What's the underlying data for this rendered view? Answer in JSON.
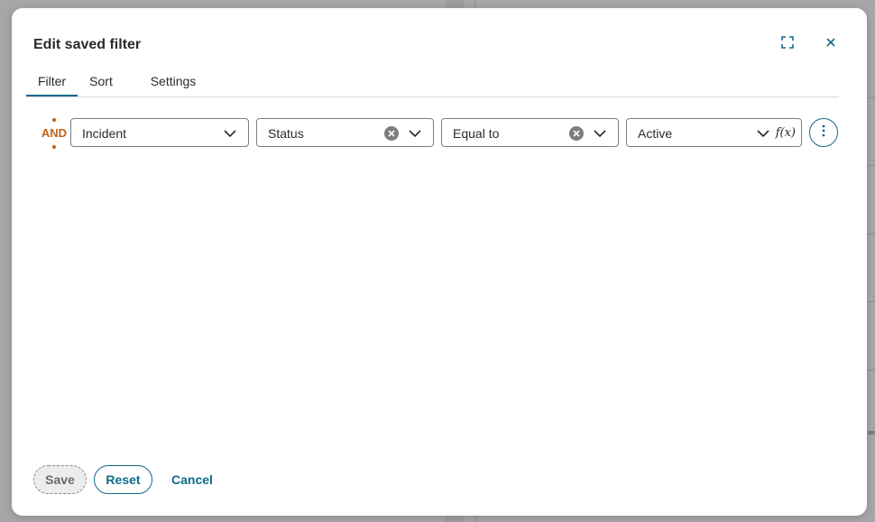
{
  "dialog": {
    "title": "Edit saved filter",
    "expand_icon": "expand-icon",
    "close_icon": "close-icon"
  },
  "tabs": [
    {
      "label": "Filter",
      "active": true
    },
    {
      "label": "Sort",
      "active": false
    },
    {
      "label": "Settings",
      "active": false
    }
  ],
  "condition": {
    "conjunction": "AND",
    "table": "Incident",
    "field": "Status",
    "operator": "Equal to",
    "value": "Active",
    "value_mode_label": "f(x)",
    "more_icon": "more-vertical-icon"
  },
  "footer": {
    "save_label": "Save",
    "reset_label": "Reset",
    "cancel_label": "Cancel"
  },
  "colors": {
    "accent": "#0c6c8a",
    "conjunction": "#c0621a",
    "overlay": "#a7a7a9"
  }
}
